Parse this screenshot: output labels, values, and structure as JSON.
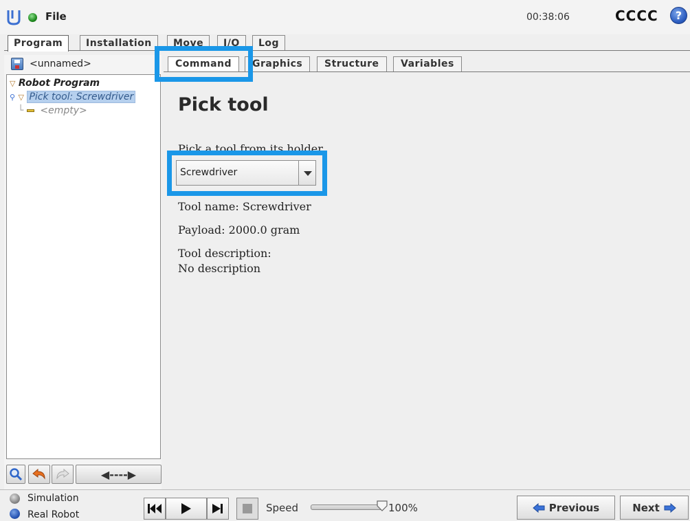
{
  "topbar": {
    "file_label": "File",
    "clock": "00:38:06",
    "robot_name": "CCCC",
    "help_glyph": "?"
  },
  "top_tabs": [
    {
      "label": "Program",
      "active": true
    },
    {
      "label": "Installation",
      "active": false
    },
    {
      "label": "Move",
      "active": false
    },
    {
      "label": "I/O",
      "active": false
    },
    {
      "label": "Log",
      "active": false
    }
  ],
  "left": {
    "program_name": "<unnamed>",
    "tree": {
      "root": "Robot Program",
      "pick": "Pick tool: Screwdriver",
      "empty": "<empty>"
    },
    "expand_glyph": "◀----▶"
  },
  "sub_tabs": [
    {
      "label": "Command",
      "active": true
    },
    {
      "label": "Graphics",
      "active": false
    },
    {
      "label": "Structure",
      "active": false
    },
    {
      "label": "Variables",
      "active": false
    }
  ],
  "content": {
    "title": "Pick tool",
    "instruction": "Pick a tool from its holder.",
    "selected_tool": "Screwdriver",
    "tool_name_line": "Tool name: Screwdriver",
    "payload_line": "Payload: 2000.0 gram",
    "description_label": "Tool description:",
    "description_value": "No description"
  },
  "bottom": {
    "simulation_label": "Simulation",
    "real_robot_label": "Real Robot",
    "selected_mode": "Real Robot",
    "speed_label": "Speed",
    "speed_value": "100%",
    "speed_fraction": 1.0,
    "previous_label": "Previous",
    "next_label": "Next"
  },
  "colors": {
    "highlight": "#1a97e8",
    "tree_selection": "#b6d0ee",
    "status_ok": "#1f8a1f"
  },
  "icons": [
    "ur-logo-icon",
    "status-dot-icon",
    "help-icon",
    "save-icon",
    "search-icon",
    "undo-icon",
    "redo-icon",
    "expand-arrows-icon",
    "rewind-icon",
    "play-icon",
    "step-icon",
    "stop-icon",
    "arrow-left-icon",
    "arrow-right-icon"
  ]
}
